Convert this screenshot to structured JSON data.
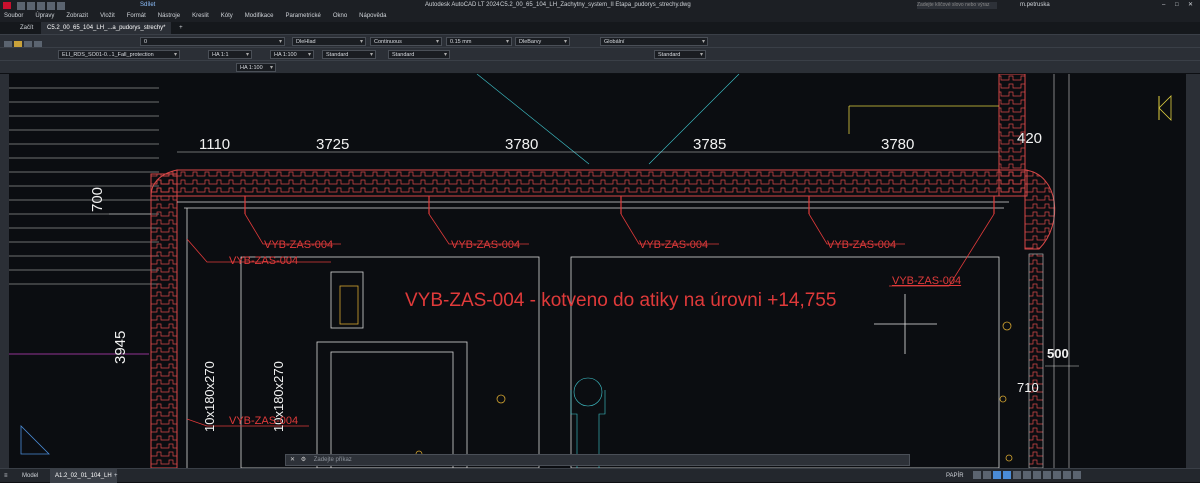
{
  "titlebar": {
    "share_label": "Sdílet",
    "app_title": "Autodesk AutoCAD LT 2024",
    "file_name": "C5.2_00_65_104_LH_Zachytny_system_II Etapa_pudorys_strechy.dwg",
    "search_placeholder": "Zadejte klíčové slovo nebo výraz",
    "user": "m.petruska"
  },
  "menu": [
    "Soubor",
    "Úpravy",
    "Zobrazit",
    "Vložit",
    "Formát",
    "Nástroje",
    "Kreslit",
    "Kóty",
    "Modifikace",
    "Parametrické",
    "Okno",
    "Nápověda"
  ],
  "doc_tabs": {
    "start": "Začít",
    "file_tab": "C5.2_00_65_104_LH_...a_pudorys_strechy*",
    "add": "+"
  },
  "toolbar": {
    "layer": "0",
    "color": "DleHlad",
    "linetype": "Continuous",
    "lineweight": "0.15 mm",
    "plotstyle": "DleBarvy",
    "ucs": "Globální",
    "layer2": "ELI_RDS_SO01-0...1_Fall_protection",
    "scale1": "HA 1:1",
    "scale2": "HA 1:100",
    "textstyle": "Standard",
    "dimstyle": "Standard",
    "tablestyle": "Standard",
    "scale3": "HA 1:100"
  },
  "drawing": {
    "dims_top": [
      "1110",
      "3725",
      "3780",
      "3785",
      "3780",
      "420"
    ],
    "dim_left_700": "700",
    "dim_left_3945": "3945",
    "dim_right_500": "500",
    "dim_right_710": "710",
    "vertical_labels": [
      "10x180x270",
      "10x180x270"
    ],
    "anchor_tag": "VYB-ZAS-004",
    "note": "VYB-ZAS-004  - kotveno do atiky na úrovni +14,755"
  },
  "command": {
    "placeholder": "Zadejte příkaz"
  },
  "status": {
    "model_tab": "Model",
    "layout_tab": "A1.2_02_01_104_LH",
    "space": "PAPÍR"
  }
}
